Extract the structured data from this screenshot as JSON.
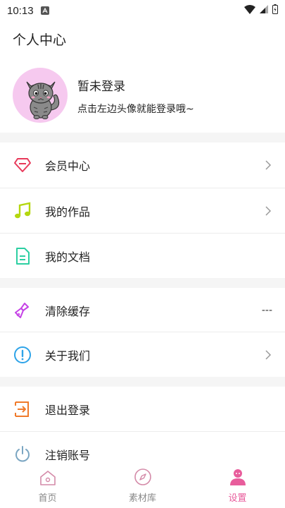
{
  "status_bar": {
    "time": "10:13"
  },
  "header": {
    "title": "个人中心"
  },
  "profile": {
    "name": "暂未登录",
    "hint": "点击左边头像就能登录哦~"
  },
  "menu_group1": [
    {
      "label": "会员中心",
      "icon": "diamond-icon",
      "color": "#e8395a"
    },
    {
      "label": "我的作品",
      "icon": "music-note-icon",
      "color": "#b4d70f"
    },
    {
      "label": "我的文档",
      "icon": "document-icon",
      "color": "#2ccfa2"
    }
  ],
  "menu_group2": [
    {
      "label": "清除缓存",
      "icon": "broom-icon",
      "color": "#c542e6",
      "value": "---"
    },
    {
      "label": "关于我们",
      "icon": "info-icon",
      "color": "#2da3e8"
    }
  ],
  "menu_group3": [
    {
      "label": "退出登录",
      "icon": "logout-icon",
      "color": "#f07a2a"
    },
    {
      "label": "注销账号",
      "icon": "power-icon",
      "color": "#7ba6c2"
    }
  ],
  "tabbar": {
    "tabs": [
      {
        "label": "首页",
        "icon": "home-icon"
      },
      {
        "label": "素材库",
        "icon": "compass-icon"
      },
      {
        "label": "设置",
        "icon": "user-icon"
      }
    ],
    "active_color": "#e85d9c"
  }
}
